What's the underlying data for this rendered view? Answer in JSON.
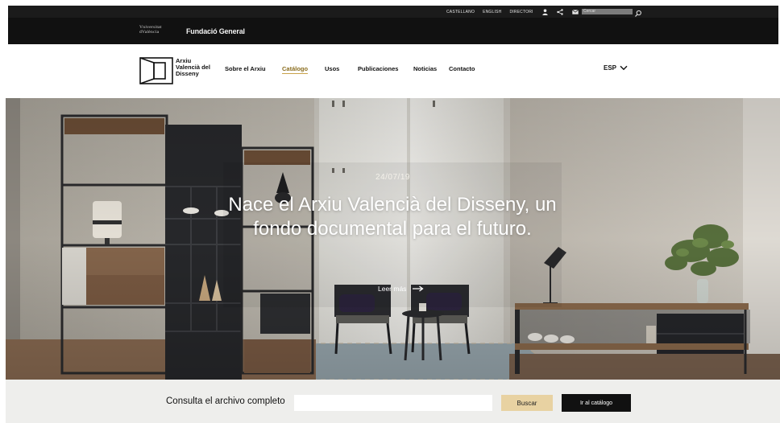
{
  "utility": {
    "links": [
      "CASTELLANO",
      "ENGLISH",
      "DIRECTORI"
    ],
    "search_placeholder": "Cercar",
    "icons": [
      "user-icon",
      "share-icon",
      "mail-icon",
      "search-icon"
    ]
  },
  "university": {
    "logo_line1": "Vniversitat",
    "logo_line2": "dValència",
    "fundacio": "Fundació General"
  },
  "nav": {
    "brand_line1": "Arxiu",
    "brand_line2": "Valencià del",
    "brand_line3": "Disseny",
    "items": [
      "Sobre el Arxiu",
      "Catálogo",
      "Usos",
      "Publicaciones",
      "Noticias",
      "Contacto"
    ],
    "active_index": 1,
    "language": "ESP"
  },
  "hero": {
    "date": "24/07/19",
    "title": "Nace el Arxiu Valencià del Disseny, un fondo documental para el futuro.",
    "link_label": "Leer más"
  },
  "search": {
    "label": "Consulta el archivo completo",
    "input_value": "",
    "button_label": "Buscar",
    "catalog_button": "Ir al catálogo"
  },
  "colors": {
    "utility_bg": "#1b1b1b",
    "uni_bg": "#111111",
    "accent_gold": "#c9a24a",
    "buscar_bg": "#e8d2a2",
    "search_strip_bg": "#eeeeec"
  }
}
